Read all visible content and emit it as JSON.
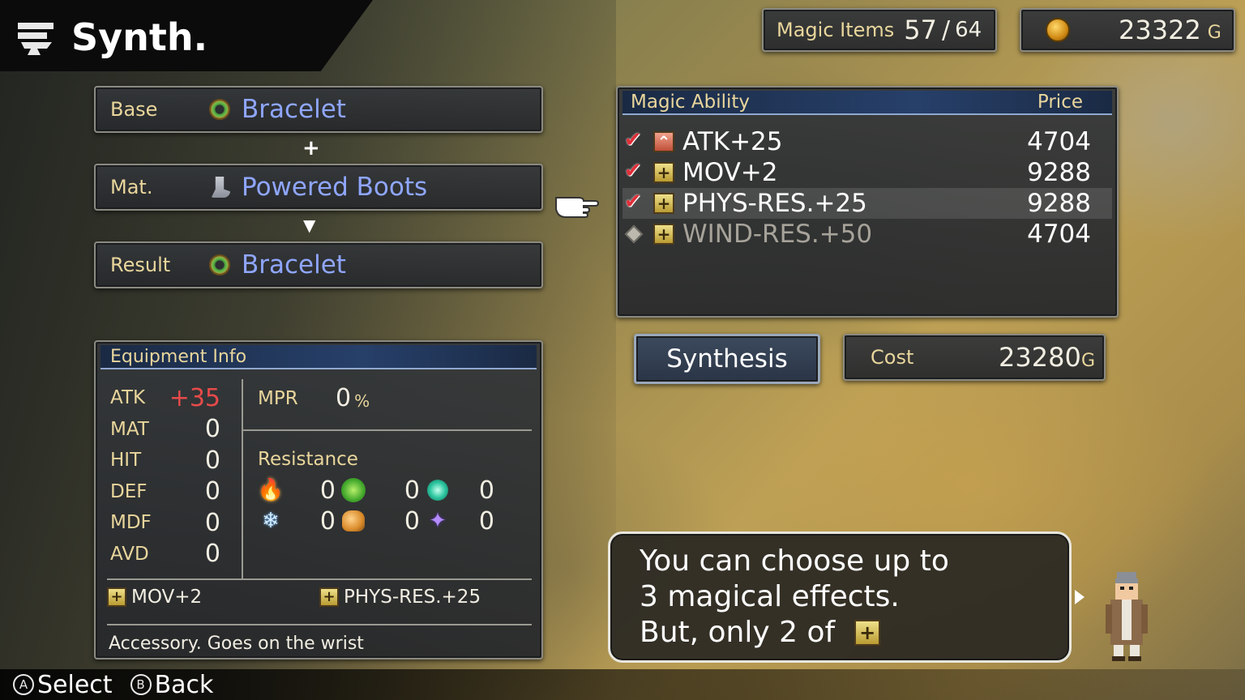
{
  "header": {
    "title": "Synth."
  },
  "counters": {
    "magic_items_label": "Magic Items",
    "magic_items_count": "57",
    "magic_items_max": "64",
    "slash": "/",
    "gold": "23322",
    "gold_suffix": "G"
  },
  "synthesis": {
    "base_label": "Base",
    "base_value": "Bracelet",
    "mat_label": "Mat.",
    "mat_value": "Powered Boots",
    "result_label": "Result",
    "result_value": "Bracelet",
    "plus_glyph": "+",
    "arrow_glyph": "▼"
  },
  "magic_ability": {
    "header_label": "Magic Ability",
    "price_header": "Price",
    "items": [
      {
        "name": "ATK+25",
        "price": "4704",
        "checked": true,
        "type": "atk-icon"
      },
      {
        "name": "MOV+2",
        "price": "9288",
        "checked": true,
        "type": "plus-icon"
      },
      {
        "name": "PHYS-RES.+25",
        "price": "9288",
        "checked": true,
        "type": "plus-icon",
        "selected": true
      },
      {
        "name": "WIND-RES.+50",
        "price": "4704",
        "checked": false,
        "type": "plus-icon",
        "disabled": true
      }
    ]
  },
  "synthesis_button": {
    "label": "Synthesis"
  },
  "cost": {
    "label": "Cost",
    "value": "23280",
    "suffix": "G"
  },
  "equipment_info": {
    "header_label": "Equipment Info",
    "stats": [
      {
        "label": "ATK",
        "value": "+35"
      },
      {
        "label": "MAT",
        "value": "0"
      },
      {
        "label": "HIT",
        "value": "0"
      },
      {
        "label": "DEF",
        "value": "0"
      },
      {
        "label": "MDF",
        "value": "0"
      },
      {
        "label": "AVD",
        "value": "0"
      }
    ],
    "mpr_label": "MPR",
    "mpr_value": "0",
    "mpr_unit": "%",
    "resistance_label": "Resistance",
    "resistances": {
      "fire": "0",
      "wind": "0",
      "water": "0",
      "ice": "0",
      "earth": "0",
      "dark": "0"
    },
    "abilities": [
      "MOV+2",
      "PHYS-RES.+25"
    ],
    "description": "Accessory. Goes on the wrist"
  },
  "dialog": {
    "line1": "You can choose up to",
    "line2": "3 magical effects.",
    "line3": "But, only 2 of"
  },
  "help": {
    "select_glyph": "A",
    "select_label": "Select",
    "back_glyph": "B",
    "back_label": "Back"
  },
  "colors": {
    "accent_gold": "#e9d69c",
    "item_blue": "#8fa6ff",
    "stat_red": "#e64a4a"
  }
}
